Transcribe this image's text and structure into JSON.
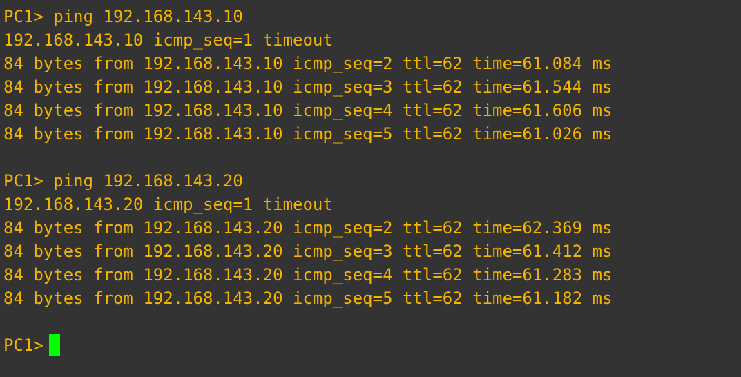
{
  "colors": {
    "background": "#333333",
    "text": "#f5b400",
    "cursor": "#00ff00"
  },
  "terminal": {
    "block1": {
      "command": "PC1> ping 192.168.143.10",
      "lines": [
        "192.168.143.10 icmp_seq=1 timeout",
        "84 bytes from 192.168.143.10 icmp_seq=2 ttl=62 time=61.084 ms",
        "84 bytes from 192.168.143.10 icmp_seq=3 ttl=62 time=61.544 ms",
        "84 bytes from 192.168.143.10 icmp_seq=4 ttl=62 time=61.606 ms",
        "84 bytes from 192.168.143.10 icmp_seq=5 ttl=62 time=61.026 ms"
      ]
    },
    "block2": {
      "command": "PC1> ping 192.168.143.20",
      "lines": [
        "192.168.143.20 icmp_seq=1 timeout",
        "84 bytes from 192.168.143.20 icmp_seq=2 ttl=62 time=62.369 ms",
        "84 bytes from 192.168.143.20 icmp_seq=3 ttl=62 time=61.412 ms",
        "84 bytes from 192.168.143.20 icmp_seq=4 ttl=62 time=61.283 ms",
        "84 bytes from 192.168.143.20 icmp_seq=5 ttl=62 time=61.182 ms"
      ]
    },
    "prompt": "PC1>"
  }
}
